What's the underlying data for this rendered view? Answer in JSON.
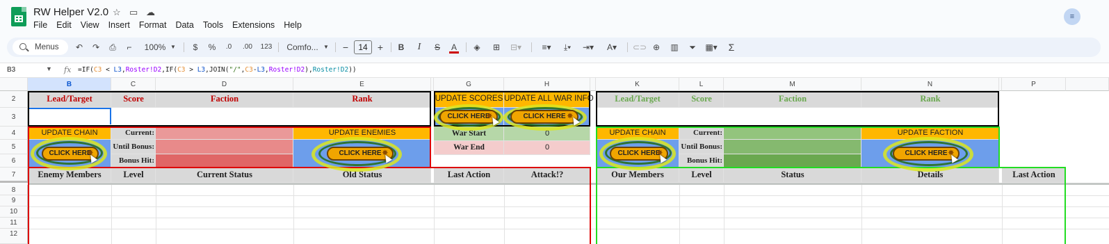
{
  "app": {
    "doc_title": "RW Helper V2.0",
    "icons": [
      "star-icon",
      "move-to-folder-icon",
      "cloud-saved-icon"
    ],
    "menu": [
      "File",
      "Edit",
      "View",
      "Insert",
      "Format",
      "Data",
      "Tools",
      "Extensions",
      "Help"
    ]
  },
  "toolbar": {
    "menus_label": "Menus",
    "zoom": "100%",
    "currency": "$",
    "percent": "%",
    "decimal_decrease": ".0",
    "decimal_increase": ".00",
    "number_format": "123",
    "font": "Comfo...",
    "minus": "−",
    "font_size": "14",
    "plus": "+",
    "bold": "B",
    "italic": "I",
    "strike": "S",
    "text_color": "A",
    "sigma": "Σ"
  },
  "formula_bar": {
    "cell_ref": "B3",
    "fx": "fx",
    "formula_parts": [
      "=IF(",
      "C3",
      " < ",
      "L3",
      ",",
      "Roster!D2",
      ",IF(",
      "C3",
      " > ",
      "L3",
      ",JOIN(",
      "\"/\"",
      ",",
      "C3",
      "-",
      "L3",
      ",",
      "Roster!D2",
      "),",
      "Roster!D2",
      "))"
    ]
  },
  "columns": [
    "B",
    "C",
    "D",
    "E",
    "G",
    "H",
    "K",
    "L",
    "M",
    "N",
    "P"
  ],
  "rows": [
    "2",
    "3",
    "4",
    "5",
    "6",
    "7",
    "8",
    "9",
    "10",
    "11",
    "12"
  ],
  "left": {
    "headers": [
      "Lead/Target",
      "Score",
      "Faction",
      "Rank"
    ],
    "update_chain": "UPDATE CHAIN",
    "update_enemies": "UPDATE ENEMIES",
    "current": "Current:",
    "until_bonus": "Until Bonus:",
    "bonus_hit": "Bonus Hit:",
    "click_here": "CLICK HERE",
    "list_headers": [
      "Enemy Members",
      "Level",
      "Current Status",
      "Old Status",
      "Last Action",
      "Attack!?"
    ]
  },
  "middle": {
    "update_scores": "UPDATE SCORES",
    "update_all": "UPDATE ALL WAR INFO",
    "click_here": "CLICK HERE",
    "war_start": "War Start",
    "war_start_val": "0",
    "war_end": "War End",
    "war_end_val": "0"
  },
  "right": {
    "headers": [
      "Lead/Target",
      "Score",
      "Faction",
      "Rank"
    ],
    "update_chain": "UPDATE CHAIN",
    "update_faction": "UPDATE FACTION",
    "current": "Current:",
    "until_bonus": "Until Bonus:",
    "bonus_hit": "Bonus Hit:",
    "click_here": "CLICK HERE",
    "list_headers": [
      "Our Members",
      "Level",
      "Status",
      "Details",
      "Last Action"
    ]
  },
  "colors": {
    "red_header": "#c00000",
    "green_header": "#6aa84f",
    "orange": "#ffb700",
    "blue": "#6d9eeb",
    "red_fill": "#e06666",
    "green_fill": "#93c47d",
    "grey": "#d9d9d9"
  }
}
